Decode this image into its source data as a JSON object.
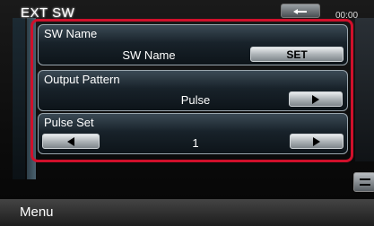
{
  "title": "EXT SW",
  "clock": "00:00",
  "rows": [
    {
      "label": "SW  Name",
      "value": "SW Name",
      "button": "SET"
    },
    {
      "label": "Output Pattern",
      "value": "Pulse"
    },
    {
      "label": "Pulse Set",
      "value": "1"
    }
  ],
  "bottom": {
    "menu_label": "Menu"
  },
  "colors": {
    "highlight": "#d0102b",
    "accent": "#4b6270"
  }
}
